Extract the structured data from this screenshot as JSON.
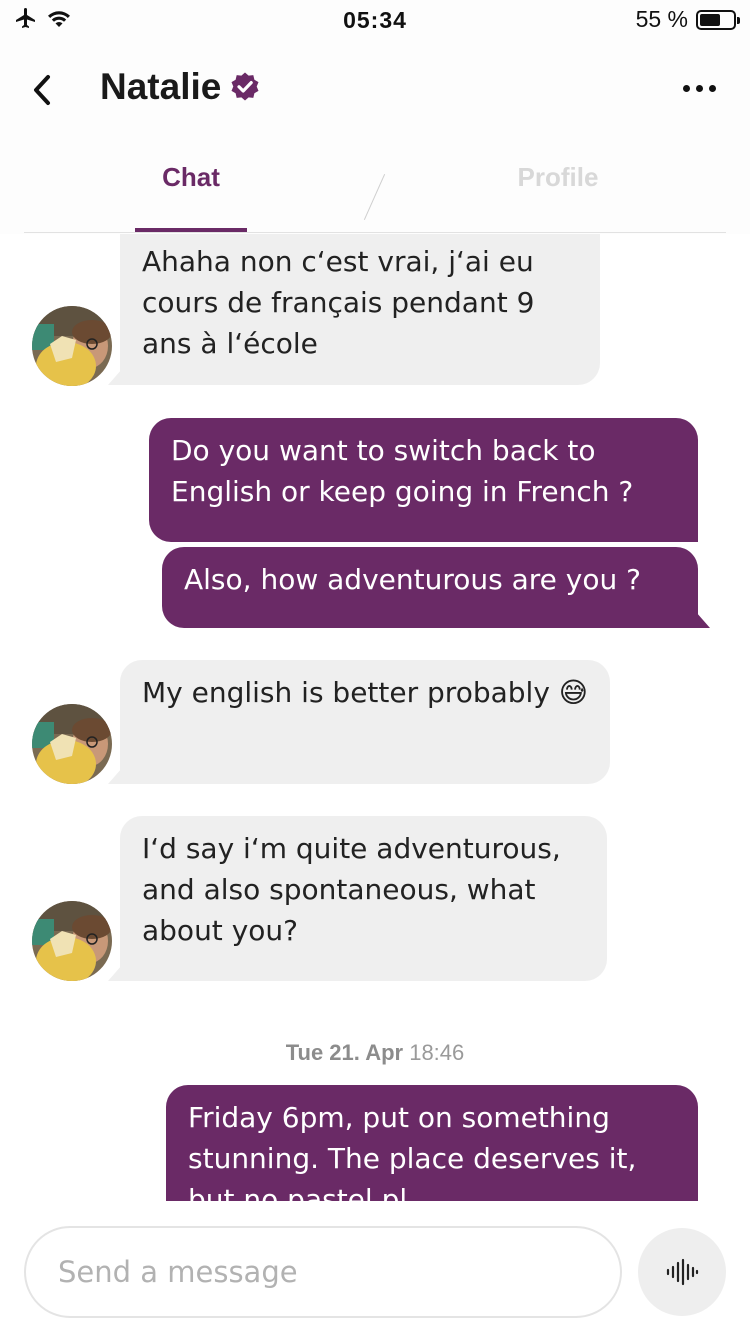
{
  "status_bar": {
    "time": "05:34",
    "battery_text": "55 %",
    "battery_level": 0.55
  },
  "header": {
    "name": "Natalie",
    "verified_icon": "verified-badge-icon"
  },
  "tabs": [
    {
      "label": "Chat",
      "active": true
    },
    {
      "label": "Profile",
      "active": false
    }
  ],
  "messages": [
    {
      "from": "them",
      "text": "Ahaha non c‘est vrai, j‘ai eu cours de français pendant 9 ans à l‘école"
    },
    {
      "from": "me",
      "text": "Do you want to switch back to English or keep going in French ?"
    },
    {
      "from": "me",
      "text": "Also, how adventurous are you ?"
    },
    {
      "from": "them",
      "text": "My english is better probably 😅"
    },
    {
      "from": "them",
      "text": "I‘d say i‘m quite adventurous, and also spontaneous, what about you?"
    },
    {
      "from": "me",
      "text": "Friday 6pm, put on something stunning. The place deserves it, but no pastel pl..."
    }
  ],
  "date_separator": {
    "date": "Tue 21. Apr",
    "time": "18:46"
  },
  "composer": {
    "placeholder": "Send a message"
  },
  "colors": {
    "accent": "#6a2a66",
    "incoming_bubble": "#efefef",
    "muted_tab": "#d8d8d8"
  }
}
